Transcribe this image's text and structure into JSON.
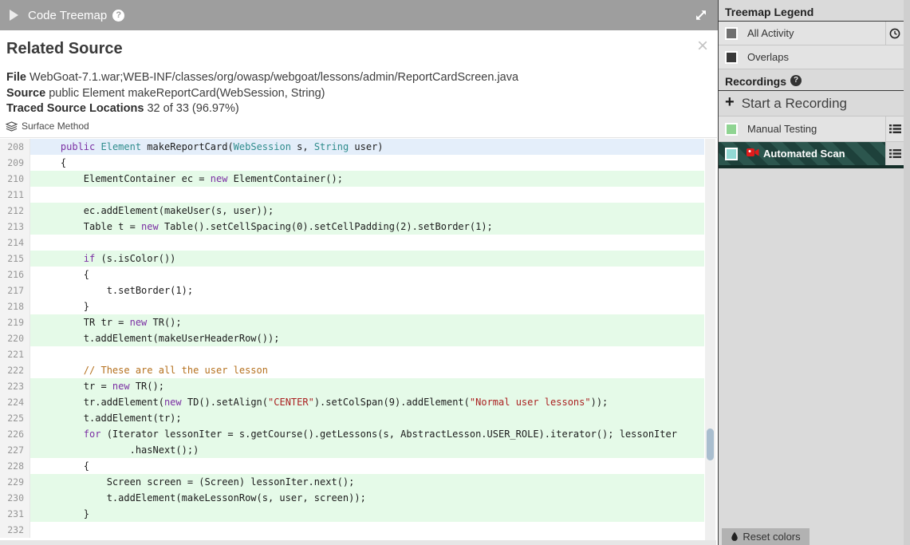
{
  "header": {
    "title": "Code Treemap",
    "help": "?"
  },
  "panel": {
    "title": "Related Source",
    "close": "×",
    "file_label": "File",
    "file_value": "WebGoat-7.1.war;WEB-INF/classes/org/owasp/webgoat/lessons/admin/ReportCardScreen.java",
    "source_label": "Source",
    "source_value": "public Element makeReportCard(WebSession, String)",
    "traced_label": "Traced Source Locations",
    "traced_value": "32 of 33 (96.97%)",
    "surface_method": "Surface Method"
  },
  "code": {
    "highlight_colors": {
      "current_line": "#e4eefa",
      "traced_line": "#e5fae8"
    },
    "lines": [
      {
        "n": 208,
        "hl": "blue",
        "seg": [
          [
            "    ",
            ""
          ],
          [
            "public",
            "k"
          ],
          [
            " ",
            ""
          ],
          [
            "Element",
            "t"
          ],
          [
            " makeReportCard(",
            ""
          ],
          [
            "WebSession",
            "t"
          ],
          [
            " s, ",
            ""
          ],
          [
            "String",
            "t"
          ],
          [
            " user)",
            ""
          ]
        ]
      },
      {
        "n": 209,
        "hl": "none",
        "seg": [
          [
            "    {",
            ""
          ]
        ]
      },
      {
        "n": 210,
        "hl": "green",
        "seg": [
          [
            "        ElementContainer ec = ",
            ""
          ],
          [
            "new",
            "k"
          ],
          [
            " ElementContainer();",
            ""
          ]
        ]
      },
      {
        "n": 211,
        "hl": "none",
        "seg": []
      },
      {
        "n": 212,
        "hl": "green",
        "seg": [
          [
            "        ec.addElement(makeUser(s, user));",
            ""
          ]
        ]
      },
      {
        "n": 213,
        "hl": "green",
        "seg": [
          [
            "        Table t = ",
            ""
          ],
          [
            "new",
            "k"
          ],
          [
            " Table().setCellSpacing(0).setCellPadding(2).setBorder(1);",
            ""
          ]
        ]
      },
      {
        "n": 214,
        "hl": "none",
        "seg": []
      },
      {
        "n": 215,
        "hl": "green",
        "seg": [
          [
            "        ",
            ""
          ],
          [
            "if",
            "k"
          ],
          [
            " (s.isColor())",
            ""
          ]
        ]
      },
      {
        "n": 216,
        "hl": "none",
        "seg": [
          [
            "        {",
            ""
          ]
        ]
      },
      {
        "n": 217,
        "hl": "none",
        "seg": [
          [
            "            t.setBorder(1);",
            ""
          ]
        ]
      },
      {
        "n": 218,
        "hl": "none",
        "seg": [
          [
            "        }",
            ""
          ]
        ]
      },
      {
        "n": 219,
        "hl": "green",
        "seg": [
          [
            "        TR tr = ",
            ""
          ],
          [
            "new",
            "k"
          ],
          [
            " TR();",
            ""
          ]
        ]
      },
      {
        "n": 220,
        "hl": "green",
        "seg": [
          [
            "        t.addElement(makeUserHeaderRow());",
            ""
          ]
        ]
      },
      {
        "n": 221,
        "hl": "none",
        "seg": []
      },
      {
        "n": 222,
        "hl": "none",
        "seg": [
          [
            "        ",
            ""
          ],
          [
            "// These are all the user lesson",
            "c"
          ]
        ]
      },
      {
        "n": 223,
        "hl": "green",
        "seg": [
          [
            "        tr = ",
            ""
          ],
          [
            "new",
            "k"
          ],
          [
            " TR();",
            ""
          ]
        ]
      },
      {
        "n": 224,
        "hl": "green",
        "seg": [
          [
            "        tr.addElement(",
            ""
          ],
          [
            "new",
            "k"
          ],
          [
            " TD().setAlign(",
            ""
          ],
          [
            "\"CENTER\"",
            "s"
          ],
          [
            ").setColSpan(9).addElement(",
            ""
          ],
          [
            "\"Normal user lessons\"",
            "s"
          ],
          [
            "));",
            ""
          ]
        ]
      },
      {
        "n": 225,
        "hl": "green",
        "seg": [
          [
            "        t.addElement(tr);",
            ""
          ]
        ]
      },
      {
        "n": 226,
        "hl": "green",
        "seg": [
          [
            "        ",
            ""
          ],
          [
            "for",
            "k"
          ],
          [
            " (Iterator lessonIter = s.getCourse().getLessons(s, AbstractLesson.USER_ROLE).iterator(); lessonIter",
            ""
          ]
        ]
      },
      {
        "n": 227,
        "hl": "green",
        "seg": [
          [
            "                .hasNext();)",
            ""
          ]
        ]
      },
      {
        "n": 228,
        "hl": "none",
        "seg": [
          [
            "        {",
            ""
          ]
        ]
      },
      {
        "n": 229,
        "hl": "green",
        "seg": [
          [
            "            Screen screen = (Screen) lessonIter.next();",
            ""
          ]
        ]
      },
      {
        "n": 230,
        "hl": "green",
        "seg": [
          [
            "            t.addElement(makeLessonRow(s, user, screen));",
            ""
          ]
        ]
      },
      {
        "n": 231,
        "hl": "green",
        "seg": [
          [
            "        }",
            ""
          ]
        ]
      },
      {
        "n": 232,
        "hl": "none",
        "seg": []
      }
    ]
  },
  "sidebar": {
    "legend": {
      "title": "Treemap Legend",
      "items": [
        {
          "label": "All Activity",
          "swatch": "#6f6f6f"
        },
        {
          "label": "Overlaps",
          "swatch": "#383838"
        }
      ]
    },
    "recordings": {
      "title": "Recordings",
      "help": "?",
      "start_label": "Start a Recording",
      "items": [
        {
          "label": "Manual Testing",
          "swatch": "#8fd492",
          "selected": false
        },
        {
          "label": "Automated Scan",
          "swatch": "#92d9d4",
          "selected": true
        }
      ]
    },
    "selected_stripe_colors": [
      "#2c564e",
      "#1e413b"
    ],
    "reset_button": "Reset colors"
  }
}
